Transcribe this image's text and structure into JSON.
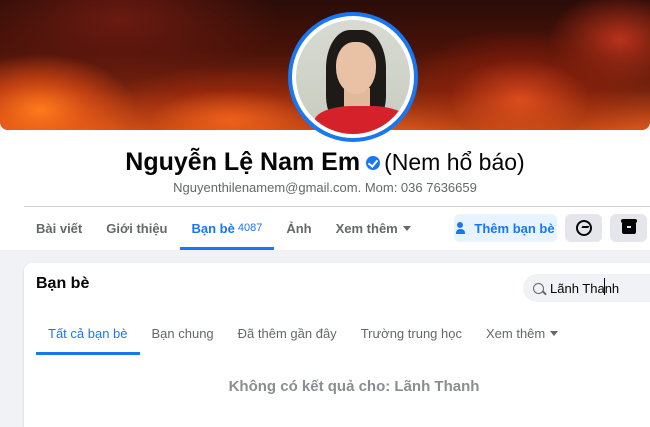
{
  "profile": {
    "name": "Nguyễn Lệ Nam Em",
    "alternate_name": "(Nem hổ báo)",
    "contact": "Nguyenthilenamem@gmail.com. Mom: 036 7636659"
  },
  "tabs": [
    {
      "label": "Bài viết"
    },
    {
      "label": "Giới thiệu"
    },
    {
      "label": "Bạn bè",
      "count": "4087",
      "active": true
    },
    {
      "label": "Ảnh"
    },
    {
      "label": "Xem thêm"
    }
  ],
  "actions": {
    "add_friend_label": "Thêm bạn bè",
    "messenger_icon": "messenger-icon",
    "more_icon": "box-icon"
  },
  "friends": {
    "title": "Bạn bè",
    "search_value": "Lãnh Thanh",
    "sub_tabs": [
      {
        "label": "Tất cả bạn bè",
        "active": true
      },
      {
        "label": "Bạn chung"
      },
      {
        "label": "Đã thêm gần đây"
      },
      {
        "label": "Trường trung học"
      },
      {
        "label": "Xem thêm"
      }
    ],
    "no_results": "Không có kết quả cho: Lãnh Thanh"
  },
  "colors": {
    "accent": "#1877f2",
    "background": "#f0f2f5",
    "secondary_text": "#65676b"
  }
}
